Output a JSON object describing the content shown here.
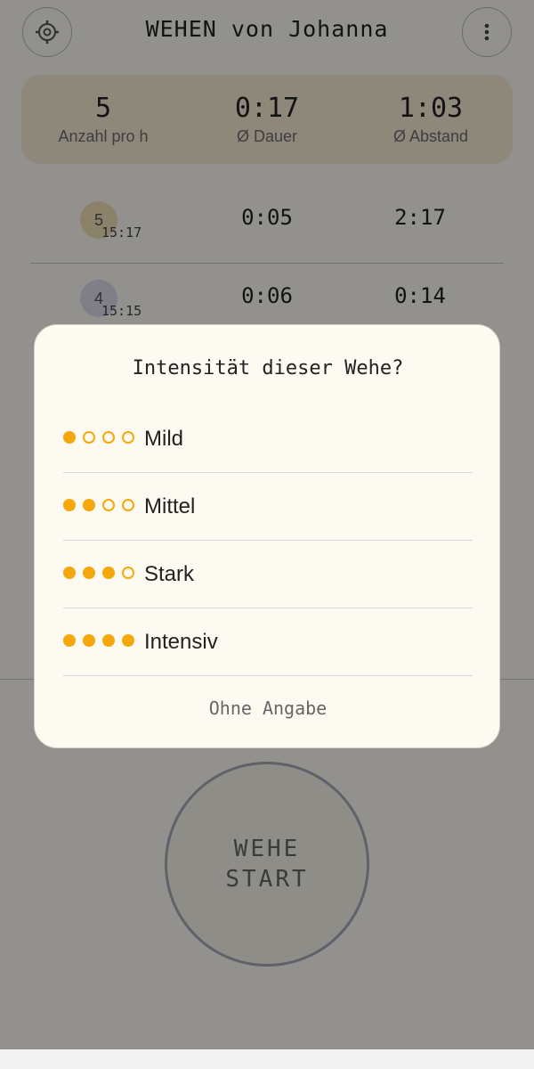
{
  "header": {
    "title": "WEHEN von Johanna",
    "settings_icon": "gear-icon",
    "menu_icon": "more-vert-icon"
  },
  "stats": [
    {
      "value": "5",
      "label": "Anzahl pro h"
    },
    {
      "value": "0:17",
      "label": "Ø Dauer"
    },
    {
      "value": "1:03",
      "label": "Ø Abstand"
    }
  ],
  "rows": [
    {
      "number": "5",
      "time": "15:17",
      "duration": "0:05",
      "gap": "2:17",
      "badge_color": "#f1dfb6"
    },
    {
      "number": "4",
      "time": "15:15",
      "duration": "0:06",
      "gap": "0:14",
      "badge_color": "#dcd9ea"
    }
  ],
  "start_button": {
    "line1": "WEHE",
    "line2": "START"
  },
  "dialog": {
    "title": "Intensität dieser Wehe?",
    "options": [
      {
        "label": "Mild",
        "level": 1
      },
      {
        "label": "Mittel",
        "level": 2
      },
      {
        "label": "Stark",
        "level": 3
      },
      {
        "label": "Intensiv",
        "level": 4
      }
    ],
    "skip_label": "Ohne Angabe",
    "accent_color": "#f5a80c"
  }
}
